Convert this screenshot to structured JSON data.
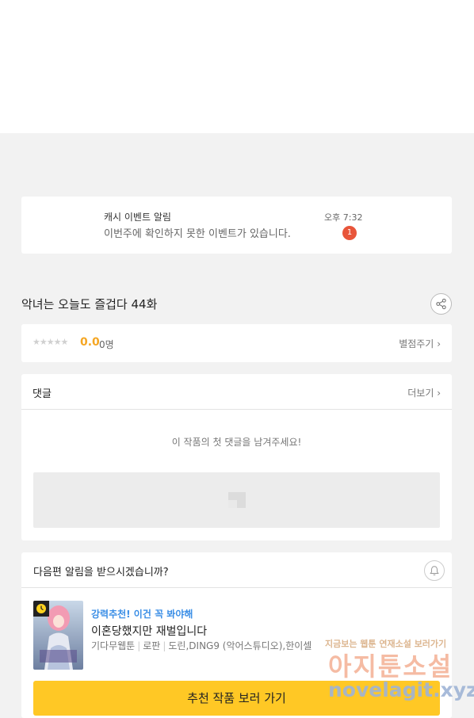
{
  "notification": {
    "title": "캐시 이벤트 알림",
    "message": "이번주에 확인하지 못한 이벤트가 있습니다.",
    "time": "오후 7:32",
    "badge": "1",
    "badge_color": "#e8553a"
  },
  "episode": {
    "title": "악녀는 오늘도 즐겁다 44화",
    "share_icon": "share-icon"
  },
  "rating": {
    "stars": "★★★★★",
    "stars_filled": 0,
    "score": "0.0",
    "people": "0명",
    "rate_link": "별점주기",
    "score_color": "#f5a623"
  },
  "comments": {
    "title": "댓글",
    "more_link": "더보기",
    "empty_message": "이 작품의 첫 댓글을 남겨주세요!"
  },
  "next_episode": {
    "question": "다음편 알림을 받으시겠습니까?",
    "bell_icon": "bell-icon"
  },
  "recommendation": {
    "label": "강력추천! 이건 꼭 봐야해",
    "title": "이혼당했지만 재벌입니다",
    "meta": [
      "기다무웹툰",
      "로판",
      "도린,DING9 (악어스튜디오),한이셀"
    ],
    "cta": "추천 작품 보러 가기",
    "cta_color": "#ffc825",
    "label_color": "#3a8ee6"
  },
  "watermark": {
    "top": "지금보는 웹툰 연재소설 보러가기",
    "main": "아지툰소설",
    "url": "novelagit.xyz"
  }
}
